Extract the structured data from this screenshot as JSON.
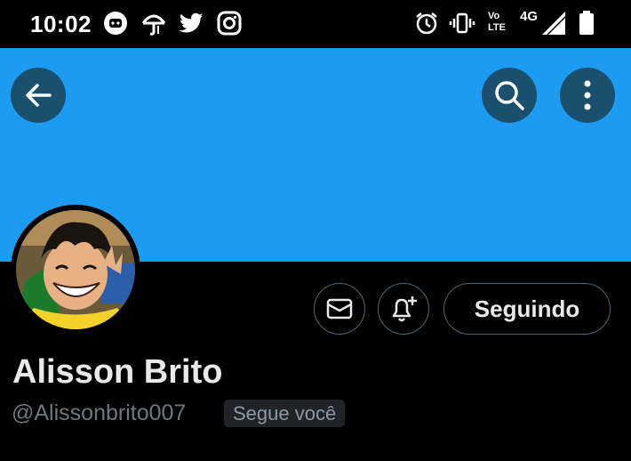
{
  "status_bar": {
    "time": "10:02",
    "left_icons": [
      "discord-icon",
      "raincoat-icon",
      "twitter-icon",
      "instagram-icon"
    ],
    "right_icons": [
      "alarm-icon",
      "vibrate-icon",
      "volte-icon",
      "signal-4g-icon",
      "battery-icon"
    ],
    "network": "4G",
    "volte_top": "Vo",
    "volte_bottom": "LTE"
  },
  "header": {
    "back_icon": "arrow-left-icon",
    "search_icon": "search-icon",
    "more_icon": "more-vertical-icon"
  },
  "profile": {
    "display_name": "Alisson Brito",
    "handle": "@Alissonbrito007",
    "follows_you_label": "Segue você",
    "following_button_label": "Seguindo",
    "message_icon": "envelope-icon",
    "notify_icon": "bell-plus-icon"
  },
  "colors": {
    "banner": "#1d9bf0",
    "background": "#000000",
    "header_button": "#1b4f6e",
    "border": "#536471"
  }
}
